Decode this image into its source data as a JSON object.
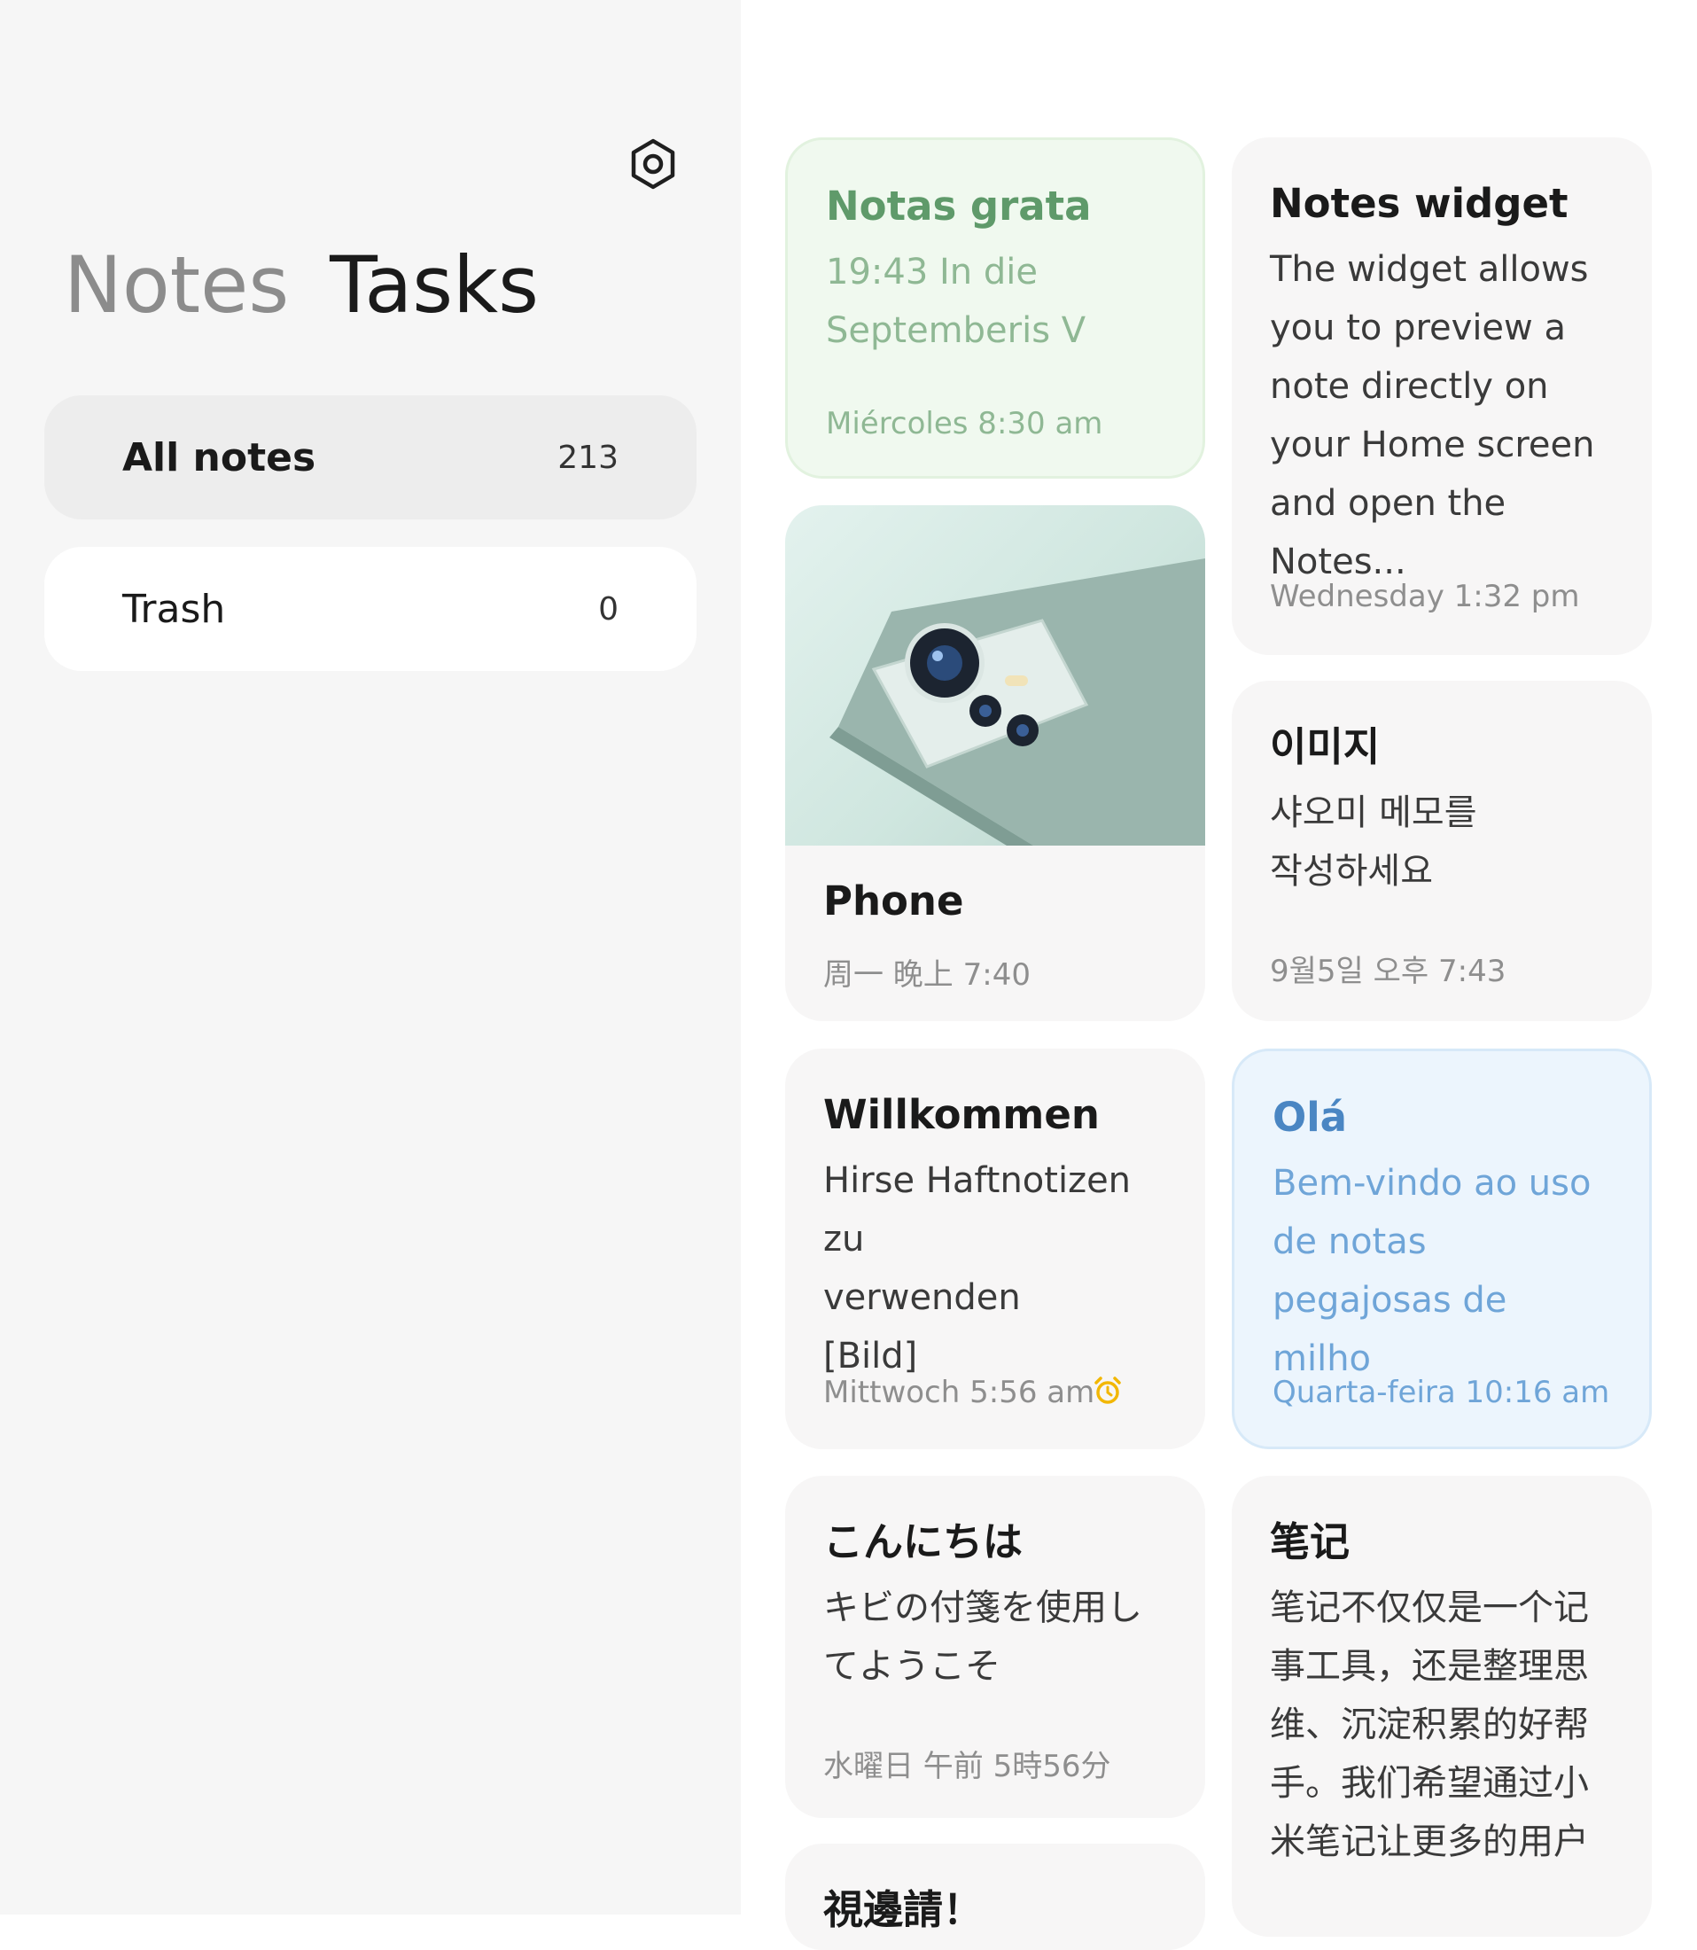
{
  "sidebar": {
    "tabs": [
      {
        "label": "Notes"
      },
      {
        "label": "Tasks"
      }
    ],
    "folders": [
      {
        "label": "All notes",
        "count": "213"
      },
      {
        "label": "Trash",
        "count": "0"
      }
    ]
  },
  "notes": [
    {
      "title": "Notas grata",
      "body": "19:43 In die Septemberis V",
      "date": "Miércoles 8:30 am",
      "color": "#f0f9ef"
    },
    {
      "title": "Notes widget",
      "body": "The widget allows you to preview a note directly on your Home screen and open the Notes...",
      "date": "Wednesday 1:32 pm"
    },
    {
      "title": "Phone",
      "date": "周一 晚上 7:40",
      "image": "phone-camera-photo"
    },
    {
      "title": "이미지",
      "body": "샤오미 메모를 작성하세요",
      "date": "9월5일 오후 7:43"
    },
    {
      "title": "Willkommen",
      "body_lines": [
        "Hirse Haftnotizen zu",
        "verwenden",
        "[Bild]"
      ],
      "date": "Mittwoch 5:56 am",
      "icon": "alarm-icon"
    },
    {
      "title": "Olá",
      "body": "Bem-vindo ao uso de notas pegajosas de milho",
      "date": "Quarta-feira 10:16 am",
      "color": "#ecf5fd"
    },
    {
      "title": "こんにちは",
      "body": "キビの付箋を使用してようこそ",
      "date": "水曜日 午前 5時56分"
    },
    {
      "title": "笔记",
      "body": "笔记不仅仅是一个记事工具，还是整理思维、沉淀积累的好帮手。我们希望通过小米笔记让更多的用户遇见更好..."
    },
    {
      "title": "視邊請！"
    }
  ],
  "colors": {
    "accent_alarm": "#f2b705",
    "green_title": "#5f9a6a",
    "blue_title": "#4a86c3"
  }
}
